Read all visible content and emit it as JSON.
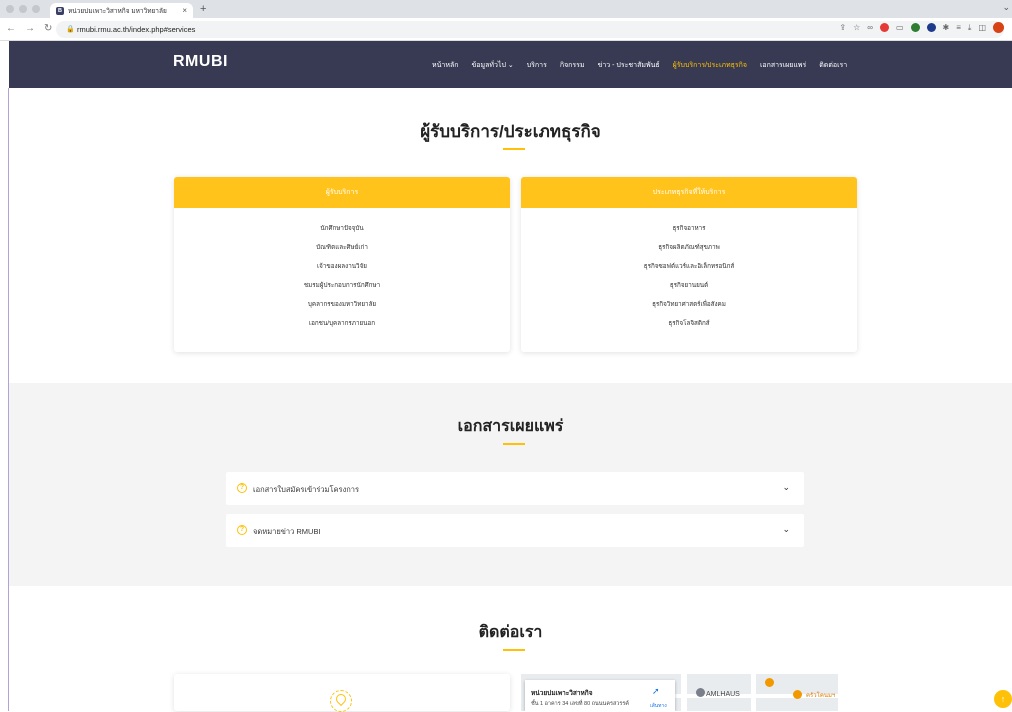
{
  "browser": {
    "tab_title": "หน่วยบ่มเพาะวิสาหกิจ มหาวิทยาลัย",
    "tab_favicon": "B",
    "url": "rmubi.rmu.ac.th/index.php#services",
    "new_tab_symbol": "+",
    "close_symbol": "×"
  },
  "nav": {
    "logo": "RMUBI",
    "items": [
      {
        "label": "หน้าหลัก",
        "active": false
      },
      {
        "label": "ข้อมูลทั่วไป ⌄",
        "active": false
      },
      {
        "label": "บริการ",
        "active": false
      },
      {
        "label": "กิจกรรม",
        "active": false
      },
      {
        "label": "ข่าว - ประชาสัมพันธ์",
        "active": false
      },
      {
        "label": "ผู้รับบริการ/ประเภทธุรกิจ",
        "active": true
      },
      {
        "label": "เอกสารเผยแพร่",
        "active": false
      },
      {
        "label": "ติดต่อเรา",
        "active": false
      }
    ],
    "accent_color": "#ffc107",
    "bg_color": "#373a52"
  },
  "services": {
    "title": "ผู้รับบริการ/ประเภทธุรกิจ",
    "clients": {
      "header": "ผู้รับบริการ",
      "items": [
        "นักศึกษาปัจจุบัน",
        "บัณฑิตและศิษย์เก่า",
        "เจ้าของผลงานวิจัย",
        "ชมรมผู้ประกอบการนักศึกษา",
        "บุคลากรของมหาวิทยาลัย",
        "เอกชน/บุคลากรภายนอก"
      ]
    },
    "business_types": {
      "header": "ประเภทธุรกิจที่ให้บริการ",
      "items": [
        "ธุรกิจอาหาร",
        "ธุรกิจผลิตภัณฑ์สุขภาพ",
        "ธุรกิจซอฟต์แวร์และอิเล็กทรอนิกส์",
        "ธุรกิจยานยนต์",
        "ธุรกิจวิทยาศาสตร์เพื่อสังคม",
        "ธุรกิจโลจิสติกส์"
      ]
    }
  },
  "documents": {
    "title": "เอกสารเผยแพร่",
    "items": [
      "เอกสารใบสมัครเข้าร่วมโครงการ",
      "จดหมายข่าว RMUBI"
    ]
  },
  "contact": {
    "title": "ติดต่อเรา",
    "map": {
      "place_name": "หน่วยบ่มเพาะวิสาหกิจ",
      "address": "ชั้น 1 อาคาร 34 เลขที่ 80 ถนนนครสวรรค์",
      "directions_label": "เส้นทาง",
      "nearby_place": "AMLHAUS",
      "nearby_place_2": "ครัวโคนมฯ"
    }
  },
  "scroll_top_symbol": "↑"
}
